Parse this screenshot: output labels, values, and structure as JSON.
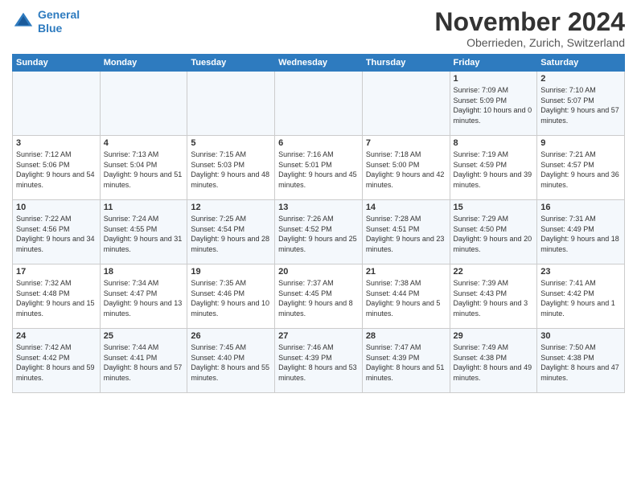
{
  "header": {
    "logo_line1": "General",
    "logo_line2": "Blue",
    "month_title": "November 2024",
    "subtitle": "Oberrieden, Zurich, Switzerland"
  },
  "weekdays": [
    "Sunday",
    "Monday",
    "Tuesday",
    "Wednesday",
    "Thursday",
    "Friday",
    "Saturday"
  ],
  "weeks": [
    [
      {
        "day": "",
        "info": ""
      },
      {
        "day": "",
        "info": ""
      },
      {
        "day": "",
        "info": ""
      },
      {
        "day": "",
        "info": ""
      },
      {
        "day": "",
        "info": ""
      },
      {
        "day": "1",
        "info": "Sunrise: 7:09 AM\nSunset: 5:09 PM\nDaylight: 10 hours and 0 minutes."
      },
      {
        "day": "2",
        "info": "Sunrise: 7:10 AM\nSunset: 5:07 PM\nDaylight: 9 hours and 57 minutes."
      }
    ],
    [
      {
        "day": "3",
        "info": "Sunrise: 7:12 AM\nSunset: 5:06 PM\nDaylight: 9 hours and 54 minutes."
      },
      {
        "day": "4",
        "info": "Sunrise: 7:13 AM\nSunset: 5:04 PM\nDaylight: 9 hours and 51 minutes."
      },
      {
        "day": "5",
        "info": "Sunrise: 7:15 AM\nSunset: 5:03 PM\nDaylight: 9 hours and 48 minutes."
      },
      {
        "day": "6",
        "info": "Sunrise: 7:16 AM\nSunset: 5:01 PM\nDaylight: 9 hours and 45 minutes."
      },
      {
        "day": "7",
        "info": "Sunrise: 7:18 AM\nSunset: 5:00 PM\nDaylight: 9 hours and 42 minutes."
      },
      {
        "day": "8",
        "info": "Sunrise: 7:19 AM\nSunset: 4:59 PM\nDaylight: 9 hours and 39 minutes."
      },
      {
        "day": "9",
        "info": "Sunrise: 7:21 AM\nSunset: 4:57 PM\nDaylight: 9 hours and 36 minutes."
      }
    ],
    [
      {
        "day": "10",
        "info": "Sunrise: 7:22 AM\nSunset: 4:56 PM\nDaylight: 9 hours and 34 minutes."
      },
      {
        "day": "11",
        "info": "Sunrise: 7:24 AM\nSunset: 4:55 PM\nDaylight: 9 hours and 31 minutes."
      },
      {
        "day": "12",
        "info": "Sunrise: 7:25 AM\nSunset: 4:54 PM\nDaylight: 9 hours and 28 minutes."
      },
      {
        "day": "13",
        "info": "Sunrise: 7:26 AM\nSunset: 4:52 PM\nDaylight: 9 hours and 25 minutes."
      },
      {
        "day": "14",
        "info": "Sunrise: 7:28 AM\nSunset: 4:51 PM\nDaylight: 9 hours and 23 minutes."
      },
      {
        "day": "15",
        "info": "Sunrise: 7:29 AM\nSunset: 4:50 PM\nDaylight: 9 hours and 20 minutes."
      },
      {
        "day": "16",
        "info": "Sunrise: 7:31 AM\nSunset: 4:49 PM\nDaylight: 9 hours and 18 minutes."
      }
    ],
    [
      {
        "day": "17",
        "info": "Sunrise: 7:32 AM\nSunset: 4:48 PM\nDaylight: 9 hours and 15 minutes."
      },
      {
        "day": "18",
        "info": "Sunrise: 7:34 AM\nSunset: 4:47 PM\nDaylight: 9 hours and 13 minutes."
      },
      {
        "day": "19",
        "info": "Sunrise: 7:35 AM\nSunset: 4:46 PM\nDaylight: 9 hours and 10 minutes."
      },
      {
        "day": "20",
        "info": "Sunrise: 7:37 AM\nSunset: 4:45 PM\nDaylight: 9 hours and 8 minutes."
      },
      {
        "day": "21",
        "info": "Sunrise: 7:38 AM\nSunset: 4:44 PM\nDaylight: 9 hours and 5 minutes."
      },
      {
        "day": "22",
        "info": "Sunrise: 7:39 AM\nSunset: 4:43 PM\nDaylight: 9 hours and 3 minutes."
      },
      {
        "day": "23",
        "info": "Sunrise: 7:41 AM\nSunset: 4:42 PM\nDaylight: 9 hours and 1 minute."
      }
    ],
    [
      {
        "day": "24",
        "info": "Sunrise: 7:42 AM\nSunset: 4:42 PM\nDaylight: 8 hours and 59 minutes."
      },
      {
        "day": "25",
        "info": "Sunrise: 7:44 AM\nSunset: 4:41 PM\nDaylight: 8 hours and 57 minutes."
      },
      {
        "day": "26",
        "info": "Sunrise: 7:45 AM\nSunset: 4:40 PM\nDaylight: 8 hours and 55 minutes."
      },
      {
        "day": "27",
        "info": "Sunrise: 7:46 AM\nSunset: 4:39 PM\nDaylight: 8 hours and 53 minutes."
      },
      {
        "day": "28",
        "info": "Sunrise: 7:47 AM\nSunset: 4:39 PM\nDaylight: 8 hours and 51 minutes."
      },
      {
        "day": "29",
        "info": "Sunrise: 7:49 AM\nSunset: 4:38 PM\nDaylight: 8 hours and 49 minutes."
      },
      {
        "day": "30",
        "info": "Sunrise: 7:50 AM\nSunset: 4:38 PM\nDaylight: 8 hours and 47 minutes."
      }
    ]
  ]
}
